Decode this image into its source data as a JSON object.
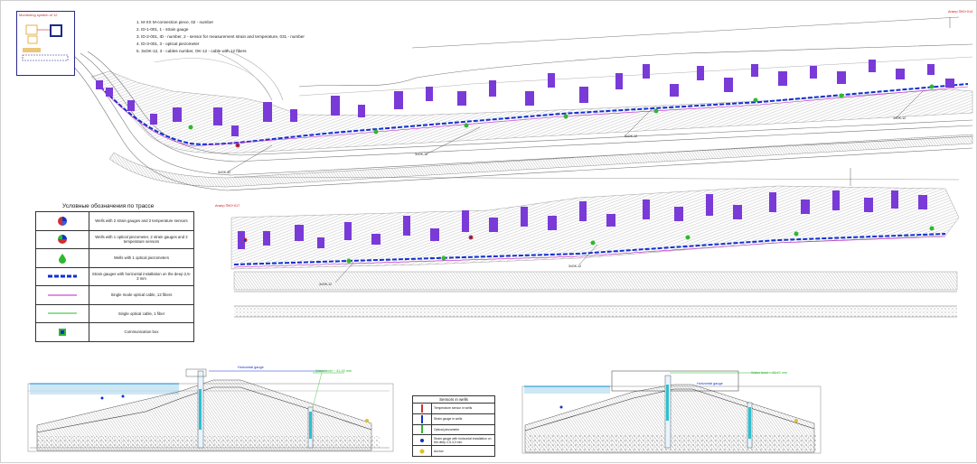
{
  "inset": {
    "title": "Monitoring system of 12",
    "colors": {
      "frame": "#2a2a8a",
      "accent": "#e0a020"
    }
  },
  "notes": [
    "1.  M-XX  M-connection piece,  02 - number",
    "2.  ID-1-001,  1 - strain gauge",
    "3.  ID-2-001,  ID  -   number,  2  -   sensor for measurement strain and temperature,  031 - number",
    "4.  ID-3-001,  3 - optical piezometer",
    "5.  3xOK-12,  3  - cables number,  OK-12  - cable with 12 fibers"
  ],
  "legend": {
    "title": "Условные обозначения по трассе",
    "rows": [
      {
        "icon": "three-color-circle-icon",
        "text": "Wells with 2 strain gauges and 2 temperature sensors"
      },
      {
        "icon": "four-color-circle-icon",
        "text": "Wells with 1 optical piezometer, 2 strain gauges and 2 temperature sensors"
      },
      {
        "icon": "green-drop-icon",
        "text": "Wells with 1 optical piezometers"
      },
      {
        "icon": "blue-dash-icon",
        "text": "Strain gauges with horizontal installation on the deep 2,5-3 mm"
      },
      {
        "icon": "magenta-line-icon",
        "text": "Single mode optical cable,  12 fibers"
      },
      {
        "icon": "green-line-icon",
        "text": "Single optical cable,  1 fiber"
      },
      {
        "icon": "communication-box-icon",
        "text": "Communication box"
      }
    ]
  },
  "section_legend": {
    "title": "Sensors in wells",
    "rows": [
      {
        "icon": "red-bar-icon",
        "text": "Temperature sensor in wells"
      },
      {
        "icon": "blue-bar-icon",
        "text": "Strain gauge in wells"
      },
      {
        "icon": "green-bar-icon",
        "text": "Optical piezometer"
      },
      {
        "icon": "blue-dot-icon",
        "text": "Strain gauge with horizontal installation on the deep 2,5-3,0 mm"
      },
      {
        "icon": "yellow-anchor-icon",
        "text": "Anchor"
      }
    ]
  },
  "plan_labels": {
    "top_cables": [
      "3xOK-12",
      "3xOK-12",
      "3xOK-12",
      "3xOK-12"
    ],
    "bottom_cables": [
      "3xOK-12",
      "3xOK-12"
    ],
    "top_right_red": "Анкер\nПК0+014",
    "bottom_left_red": "Анкер\nПК0+017",
    "top_left_red": "Анкер"
  },
  "section_labels": {
    "left_horizontal": "Horizontal gauge",
    "left_level": "Water level ~ 41,40 mm",
    "right_horizontal": "Horizontal gauge",
    "right_level": "Water level ~ 41,40 mm"
  },
  "colors": {
    "sensor_purple": "#7a3ad8",
    "cable_blue": "#1030d0",
    "piezo_green": "#2fb82f",
    "cable_magenta": "#c020c0",
    "hatch": "#888888",
    "water": "#3aa0d8"
  }
}
